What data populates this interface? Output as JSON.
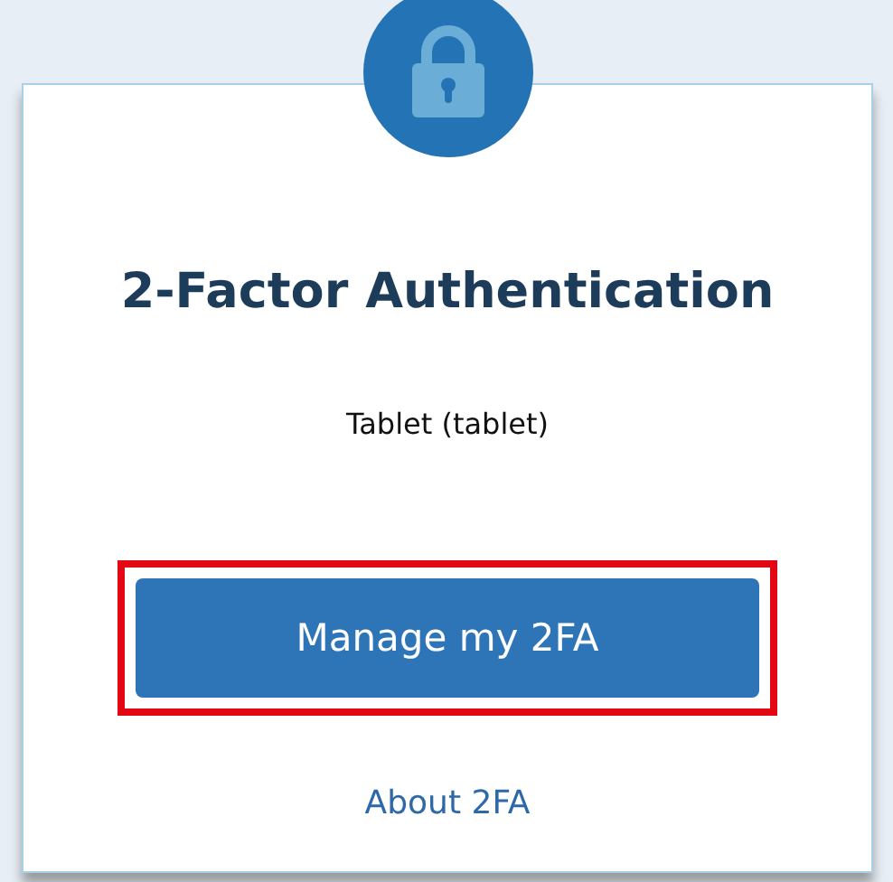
{
  "card": {
    "title": "2-Factor Authentication",
    "device": "Tablet (tablet)",
    "primary_button": {
      "label": "Manage my 2FA",
      "highlighted": true
    },
    "link": "About 2FA"
  }
}
